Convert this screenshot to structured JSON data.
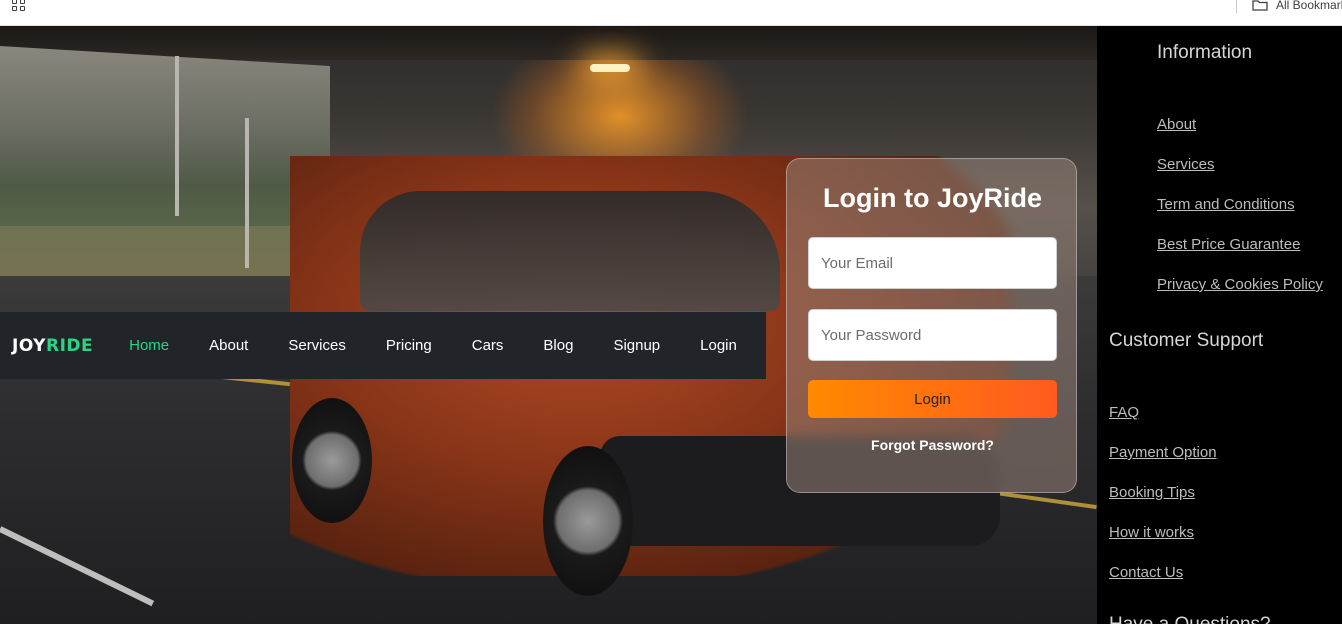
{
  "browser": {
    "apps_icon": "apps-grid-icon",
    "bookmarks_folder_icon": "folder-icon",
    "all_bookmarks_label": "All Bookmarks"
  },
  "navbar": {
    "brand_part1": "JOY",
    "brand_part2": "RIDE",
    "links": [
      "Home",
      "About",
      "Services",
      "Pricing",
      "Cars",
      "Blog",
      "Signup",
      "Login"
    ],
    "active_link": "Home",
    "accent_color": "#2ad482",
    "background_color": "#212529"
  },
  "login": {
    "title": "Login to JoyRide",
    "email_placeholder": "Your Email",
    "email_value": "",
    "password_placeholder": "Your Password",
    "password_value": "",
    "submit_label": "Login",
    "forgot_label": "Forgot Password?",
    "button_gradient": [
      "#ff8a00",
      "#ff5a1f"
    ]
  },
  "footer": {
    "information": {
      "title": "Information",
      "links": [
        "About",
        "Services",
        "Term and Conditions",
        "Best Price Guarantee",
        "Privacy & Cookies Policy"
      ]
    },
    "customer_support": {
      "title": "Customer Support",
      "links": [
        "FAQ",
        "Payment Option",
        "Booking Tips",
        "How it works",
        "Contact Us"
      ]
    },
    "partial_title": "Have a Questions?"
  }
}
